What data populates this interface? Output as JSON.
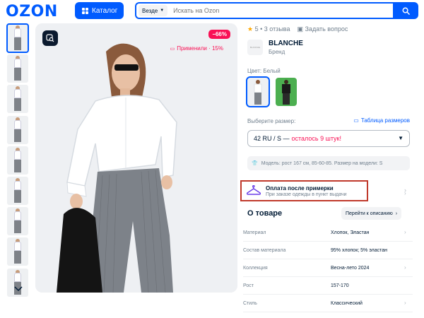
{
  "header": {
    "logo": "OZON",
    "catalog_label": "Каталог",
    "search_scope": "Везде",
    "search_placeholder": "Искать на Ozon"
  },
  "gallery": {
    "thumbnail_count": 9,
    "discount_badge": "−66%",
    "applied_label": "Применили · 15%"
  },
  "product": {
    "rating_text": "5 • 3 отзыва",
    "ask_question": "Задать вопрос",
    "brand_logo_text": "BLANCHE",
    "brand_name": "BLANCHE",
    "brand_sub": "Бренд",
    "color_label": "Цвет: Белый",
    "size_label": "Выберите размер:",
    "size_table_link": "Таблица размеров",
    "size_value": "42 RU / S —",
    "stock_note": "осталось 9 штук!",
    "model_info": "Модель: рост 167 см, 85-60-85. Размер на модели: S",
    "pay_title": "Оплата после примерки",
    "pay_subtitle": "При заказе одежды в пункт выдачи",
    "about_title": "О товаре",
    "description_button": "Перейти к описанию"
  },
  "attributes": [
    {
      "key": "Материал",
      "value": "Хлопок, Эластан"
    },
    {
      "key": "Состав материала",
      "value": "95% хлопок; 5% эластан"
    },
    {
      "key": "Коллекция",
      "value": "Весна-лето 2024"
    },
    {
      "key": "Рост",
      "value": "157-170"
    },
    {
      "key": "Стиль",
      "value": "Классический"
    }
  ],
  "colors": {
    "accent": "#005bff",
    "discount": "#f91155",
    "rating_star": "#ffa800",
    "highlight_box": "#c0392b"
  }
}
